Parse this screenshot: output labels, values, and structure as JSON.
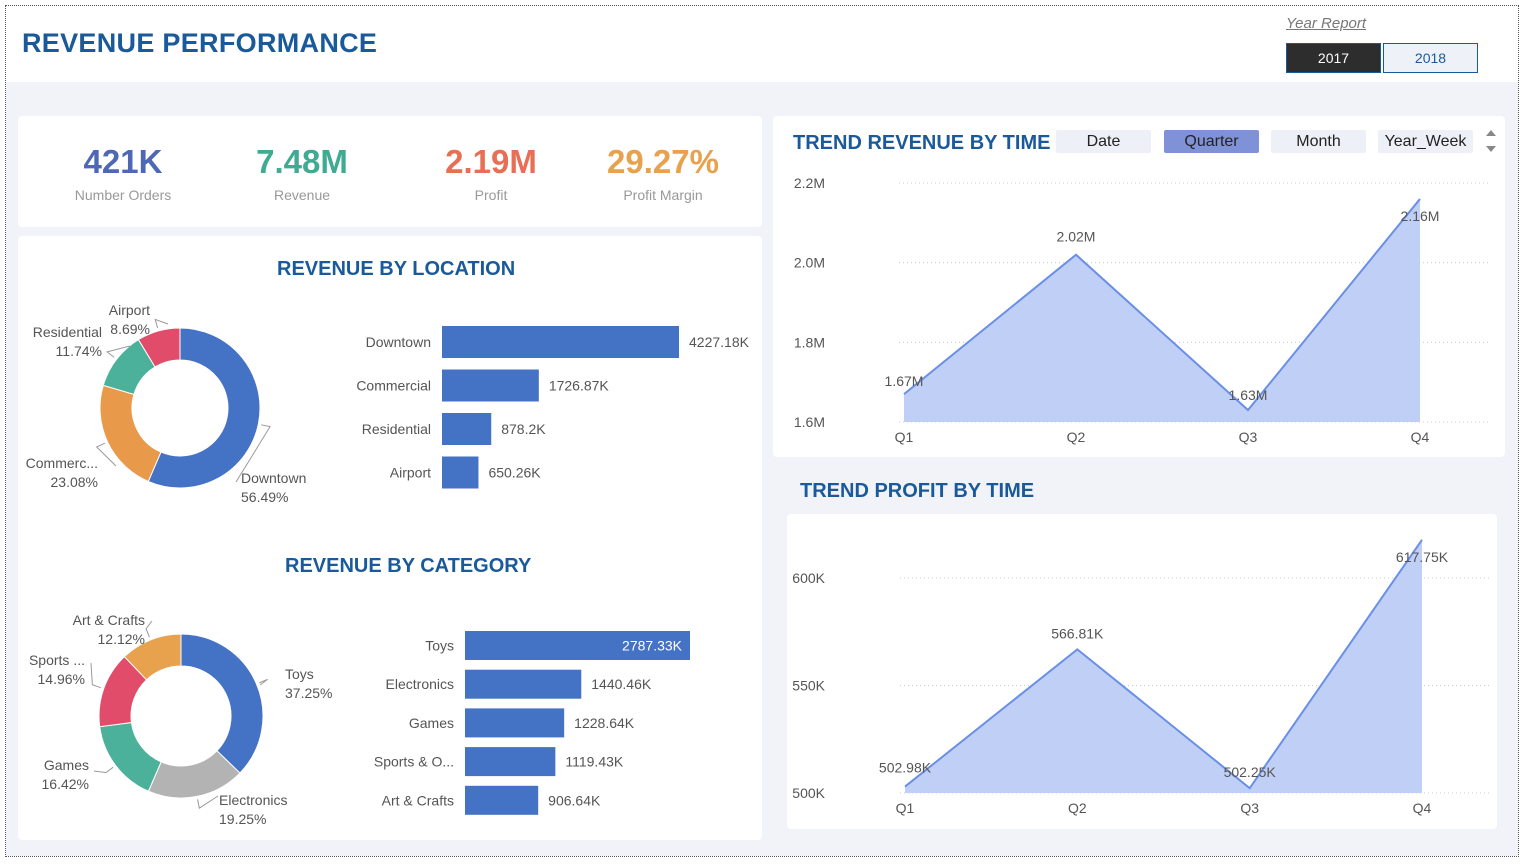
{
  "header": {
    "title": "REVENUE PERFORMANCE",
    "year_label": "Year Report",
    "years": [
      "2017",
      "2018"
    ],
    "selected_year": "2017"
  },
  "kpis": [
    {
      "value": "421K",
      "label": "Number Orders",
      "color": "#4e68b6"
    },
    {
      "value": "7.48M",
      "label": "Revenue",
      "color": "#3fab92"
    },
    {
      "value": "2.19M",
      "label": "Profit",
      "color": "#e86f54"
    },
    {
      "value": "29.27%",
      "label": "Profit Margin",
      "color": "#e8a14d"
    }
  ],
  "sections": {
    "location": "REVENUE BY LOCATION",
    "category": "REVENUE BY CATEGORY",
    "trend_revenue": "TREND REVENUE BY TIME",
    "trend_profit": "TREND PROFIT BY TIME"
  },
  "time_slicer": {
    "options": [
      "Date",
      "Quarter",
      "Month",
      "Year_Week"
    ],
    "selected": "Quarter"
  },
  "chart_data": [
    {
      "type": "pie",
      "variant": "donut",
      "slices": [
        {
          "name": "Downtown",
          "label": "Downtown",
          "pct": 56.49,
          "pct_label": "56.49%",
          "color": "#4472c4"
        },
        {
          "name": "Commercial",
          "label": "Commerc...",
          "pct": 23.08,
          "pct_label": "23.08%",
          "color": "#e8994a"
        },
        {
          "name": "Residential",
          "label": "Residential",
          "pct": 11.74,
          "pct_label": "11.74%",
          "color": "#4bb19b"
        },
        {
          "name": "Airport",
          "label": "Airport",
          "pct": 8.69,
          "pct_label": "8.69%",
          "color": "#e04c6a"
        }
      ]
    },
    {
      "type": "bar",
      "orientation": "horizontal",
      "categories": [
        "Downtown",
        "Commercial",
        "Residential",
        "Airport"
      ],
      "values": [
        4227.18,
        1726.87,
        878.2,
        650.26
      ],
      "value_labels": [
        "4227.18K",
        "1726.87K",
        "878.2K",
        "650.26K"
      ],
      "unit": "K",
      "color": "#4472c4"
    },
    {
      "type": "pie",
      "variant": "donut",
      "slices": [
        {
          "name": "Toys",
          "label": "Toys",
          "pct": 37.25,
          "pct_label": "37.25%",
          "color": "#4472c4"
        },
        {
          "name": "Electronics",
          "label": "Electronics",
          "pct": 19.25,
          "pct_label": "19.25%",
          "color": "#b3b3b3"
        },
        {
          "name": "Games",
          "label": "Games",
          "pct": 16.42,
          "pct_label": "16.42%",
          "color": "#4bb19b"
        },
        {
          "name": "Sports",
          "label": "Sports ...",
          "pct": 14.96,
          "pct_label": "14.96%",
          "color": "#e04c6a"
        },
        {
          "name": "Art & Crafts",
          "label": "Art & Crafts",
          "pct": 12.12,
          "pct_label": "12.12%",
          "color": "#e8a14d"
        }
      ]
    },
    {
      "type": "bar",
      "orientation": "horizontal",
      "categories": [
        "Toys",
        "Electronics",
        "Games",
        "Sports & O...",
        "Art & Crafts"
      ],
      "values": [
        2787.33,
        1440.46,
        1228.64,
        1119.43,
        906.64
      ],
      "value_labels": [
        "2787.33K",
        "1440.46K",
        "1228.64K",
        "1119.43K",
        "906.64K"
      ],
      "unit": "K",
      "color": "#4472c4"
    },
    {
      "type": "area",
      "x": [
        "Q1",
        "Q2",
        "Q3",
        "Q4"
      ],
      "values": [
        1.67,
        2.02,
        1.63,
        2.16
      ],
      "value_labels": [
        "1.67M",
        "2.02M",
        "1.63M",
        "2.16M"
      ],
      "ylim": [
        1.6,
        2.2
      ],
      "yticks": [
        1.6,
        1.8,
        2.0,
        2.2
      ],
      "ytick_labels": [
        "1.6M",
        "1.8M",
        "2.0M",
        "2.2M"
      ],
      "grid": true,
      "color": "#6a8fe6"
    },
    {
      "type": "area",
      "x": [
        "Q1",
        "Q2",
        "Q3",
        "Q4"
      ],
      "values": [
        502.98,
        566.81,
        502.25,
        617.75
      ],
      "value_labels": [
        "502.98K",
        "566.81K",
        "502.25K",
        "617.75K"
      ],
      "ylim": [
        500,
        620
      ],
      "yticks": [
        500,
        550,
        600
      ],
      "ytick_labels": [
        "500K",
        "550K",
        "600K"
      ],
      "grid": true,
      "color": "#6a8fe6"
    }
  ]
}
